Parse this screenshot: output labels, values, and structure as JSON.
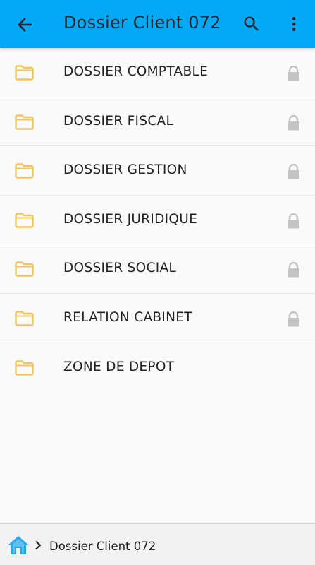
{
  "header": {
    "title": "Dossier Client 072",
    "background_color": "#03a9f4",
    "back_icon": "arrow-left-icon",
    "search_icon": "search-icon",
    "menu_icon": "more-vertical-icon"
  },
  "folders": [
    {
      "label": "DOSSIER COMPTABLE",
      "locked": true
    },
    {
      "label": "DOSSIER FISCAL",
      "locked": true
    },
    {
      "label": "DOSSIER GESTION",
      "locked": true
    },
    {
      "label": "DOSSIER JURIDIQUE",
      "locked": true
    },
    {
      "label": "DOSSIER SOCIAL",
      "locked": true
    },
    {
      "label": "RELATION CABINET",
      "locked": true
    },
    {
      "label": "ZONE DE DEPOT",
      "locked": false
    }
  ],
  "colors": {
    "folder": "#f2c55c",
    "lock": "#c4c4c4",
    "home": "#29a8e8"
  },
  "breadcrumb": {
    "home_icon": "home-icon",
    "separator_icon": "chevron-right-icon",
    "items": [
      "Dossier Client 072"
    ]
  }
}
